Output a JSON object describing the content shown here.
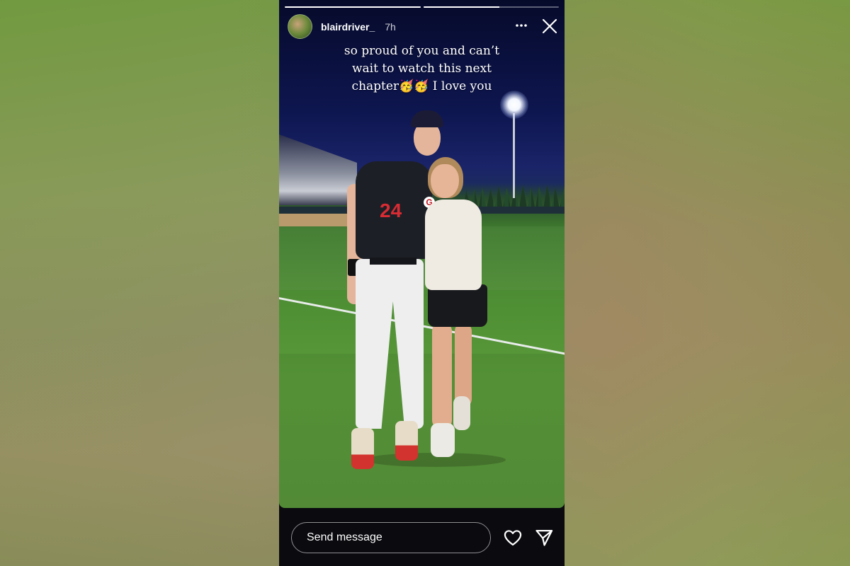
{
  "story": {
    "username": "blairdriver_",
    "time_ago": "7h",
    "caption": "so proud of you and can’t\nwait to watch this next\nchapter🥳🥳 I love you",
    "progress": [
      1.0,
      0.56
    ]
  },
  "icons": {
    "more": "more-options-icon",
    "close": "close-icon",
    "like": "heart-icon",
    "share": "send-icon"
  },
  "photo": {
    "jersey_number": "24",
    "jersey_logo": "G"
  },
  "reply": {
    "placeholder": "Send message"
  },
  "colors": {
    "background": "#0a0a0f",
    "text": "#ffffff"
  }
}
